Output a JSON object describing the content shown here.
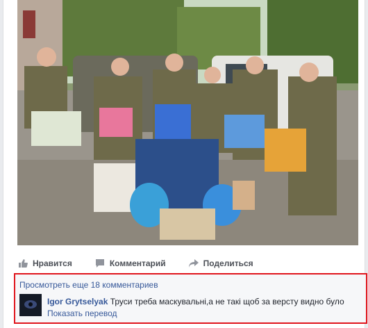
{
  "actions": {
    "like": "Нравится",
    "comment": "Комментарий",
    "share": "Поделиться"
  },
  "comments": {
    "view_more": "Просмотреть еще 18 комментариев",
    "items": [
      {
        "author": "Igor Grytselyak",
        "text": "Труси треба маскувальні,а не такі щоб за версту видно було",
        "translate": "Показать перевод"
      }
    ]
  },
  "colors": {
    "link": "#365899",
    "highlight_border": "#e0151c",
    "action_text": "#4b4f56"
  },
  "icons": [
    "like-icon",
    "comment-icon",
    "share-icon"
  ]
}
